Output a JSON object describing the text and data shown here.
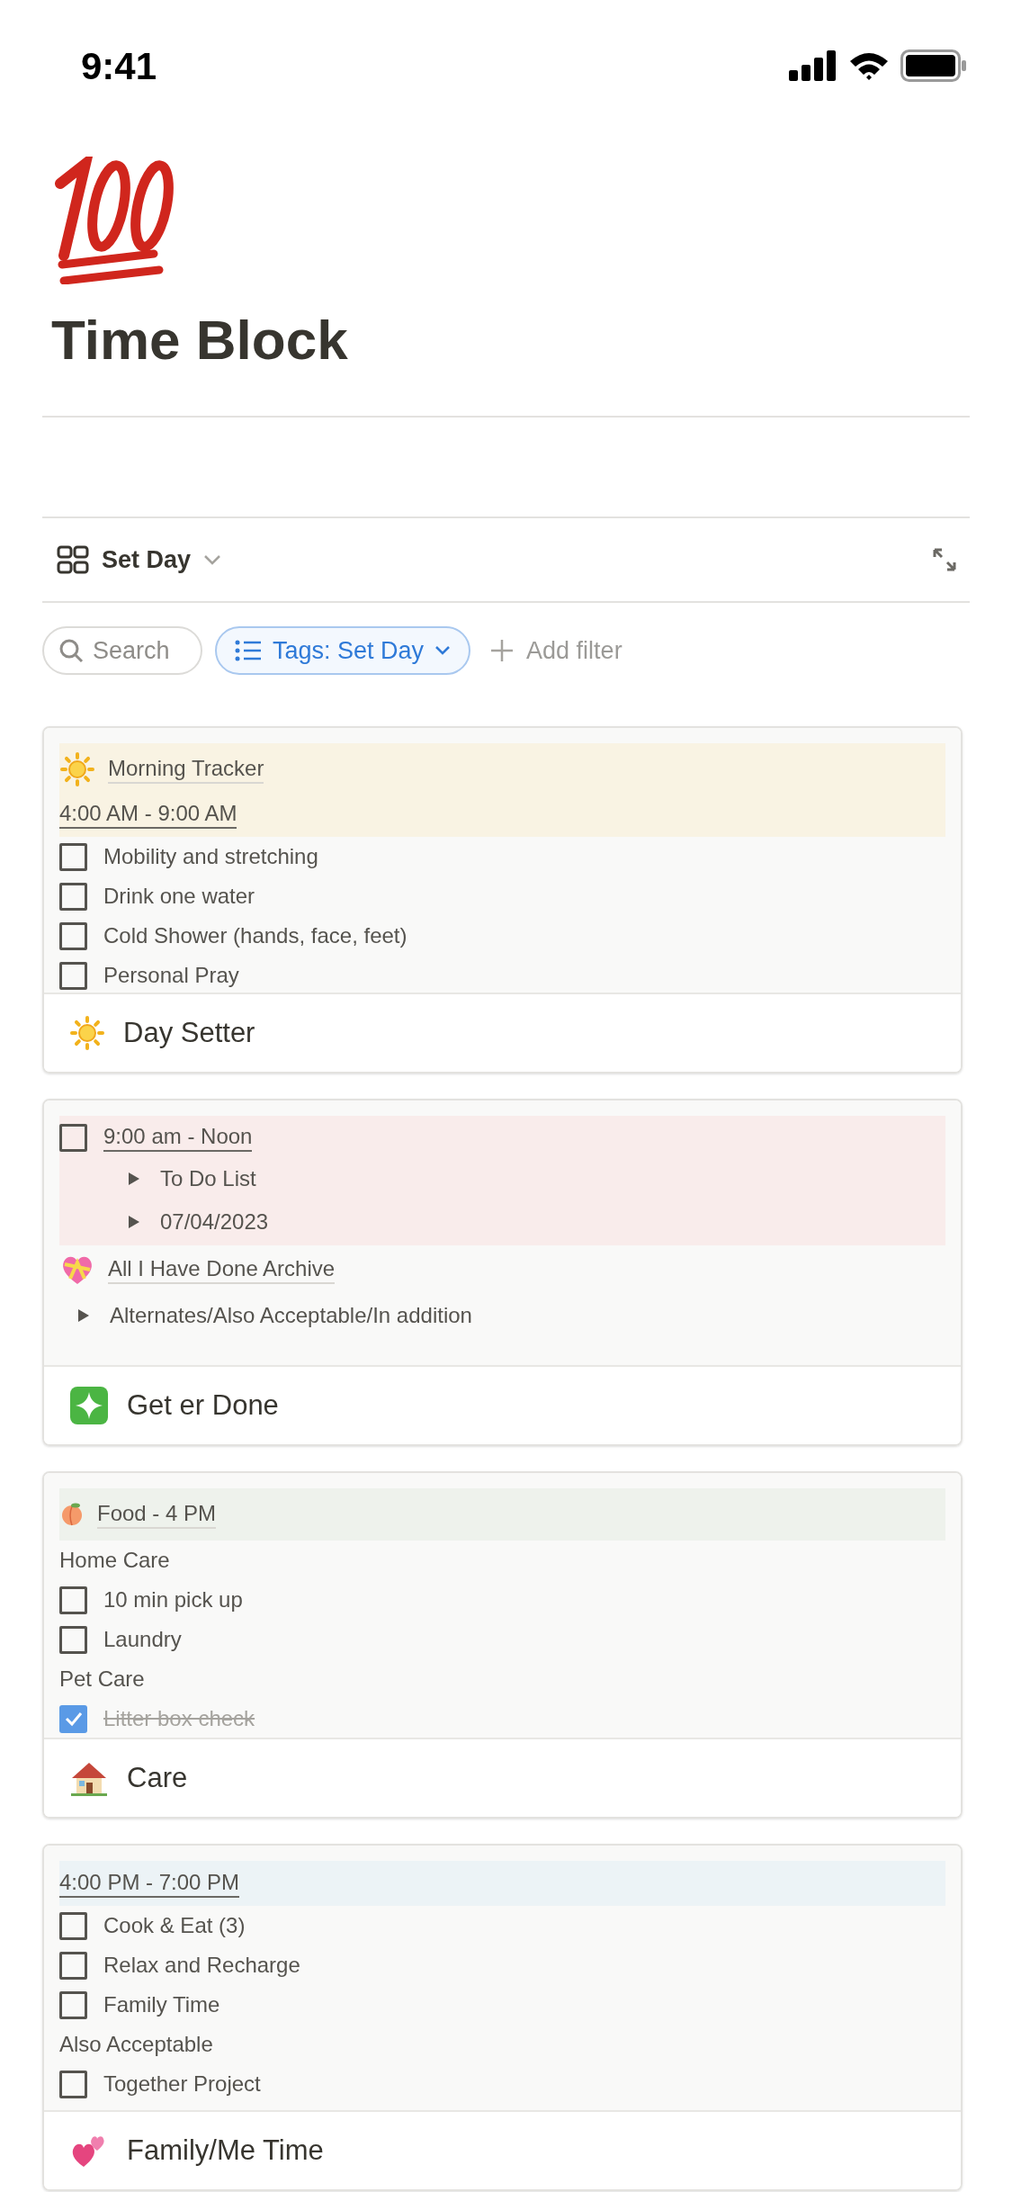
{
  "status_bar": {
    "time": "9:41"
  },
  "page": {
    "title": "Time Block"
  },
  "view": {
    "name": "Set Day"
  },
  "filters": {
    "search": {
      "placeholder": "Search"
    },
    "tag_filter": "Tags: Set Day",
    "add_filter": "Add filter"
  },
  "cards": [
    {
      "title": "Day Setter",
      "blocks": [
        {
          "color": "#f9f3e3",
          "lines": [
            {
              "kind": "link",
              "text": "Morning Tracker"
            },
            {
              "kind": "date",
              "text": "4:00 AM - 9:00 AM"
            }
          ]
        },
        {
          "lines": [
            {
              "kind": "todo",
              "text": "Mobility and stretching",
              "checked": false
            },
            {
              "kind": "todo",
              "text": "Drink one water",
              "checked": false
            },
            {
              "kind": "todo",
              "text": "Cold Shower (hands, face, feet)",
              "checked": false
            },
            {
              "kind": "todo",
              "text": "Personal Pray",
              "checked": false
            }
          ]
        }
      ]
    },
    {
      "title": "Get er Done",
      "blocks": [
        {
          "color": "#f9eceb",
          "lines": [
            {
              "kind": "todo",
              "text": "9:00 am - Noon",
              "checked": false,
              "linked": true,
              "children": [
                {
                  "kind": "toggle",
                  "text": "To Do List"
                },
                {
                  "kind": "toggle",
                  "text": "07/04/2023"
                }
              ]
            }
          ]
        },
        {
          "lines": [
            {
              "kind": "link",
              "text": "All I Have Done Archive"
            },
            {
              "kind": "toggle",
              "text": "Alternates/Also Acceptable/In addition"
            }
          ]
        }
      ]
    },
    {
      "title": "Care",
      "blocks": [
        {
          "color": "#eef2ec",
          "lines": [
            {
              "kind": "link",
              "text": "Food - 4 PM"
            }
          ]
        },
        {
          "lines": [
            {
              "kind": "text",
              "text": "Home Care"
            },
            {
              "kind": "todo",
              "text": "10 min pick up",
              "checked": false
            },
            {
              "kind": "todo",
              "text": "Laundry",
              "checked": false
            },
            {
              "kind": "text",
              "text": "Pet Care"
            },
            {
              "kind": "todo",
              "text": "Litter box check",
              "checked": true
            }
          ]
        }
      ]
    },
    {
      "title": "Family/Me Time",
      "blocks": [
        {
          "color": "#ecf3f6",
          "lines": [
            {
              "kind": "date",
              "text": "4:00 PM - 7:00 PM"
            }
          ]
        },
        {
          "lines": [
            {
              "kind": "todo",
              "text": "Cook & Eat (3)",
              "checked": false
            },
            {
              "kind": "todo",
              "text": "Relax and Recharge",
              "checked": false
            },
            {
              "kind": "todo",
              "text": "Family Time",
              "checked": false
            },
            {
              "kind": "text",
              "text": "Also Acceptable"
            },
            {
              "kind": "todo",
              "text": "Together Project",
              "checked": false
            }
          ]
        }
      ]
    }
  ]
}
